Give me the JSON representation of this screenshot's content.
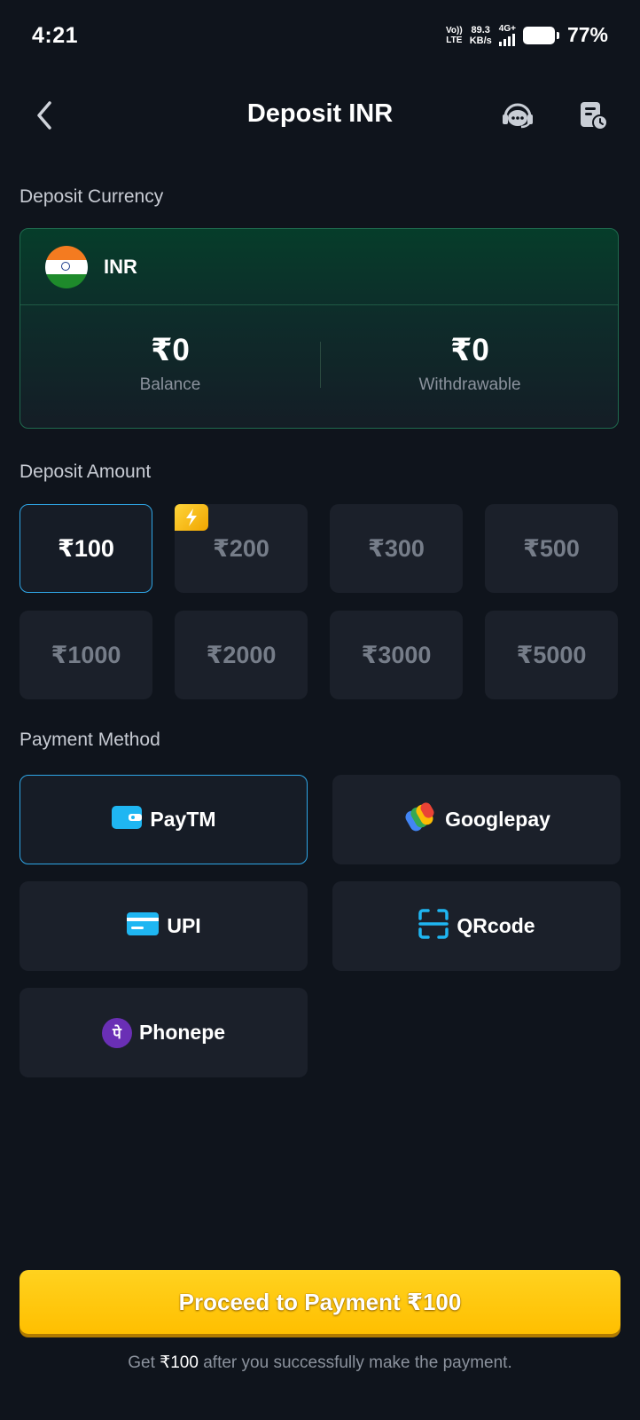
{
  "status_bar": {
    "time": "4:21",
    "network_top": "Vo))",
    "network_bottom": "LTE",
    "speed_value": "89.3",
    "speed_unit": "KB/s",
    "signal_type": "4G+",
    "battery": "77%"
  },
  "header": {
    "title": "Deposit INR",
    "back_icon": "chevron-left-icon",
    "support_icon": "support-chat-icon",
    "history_icon": "history-receipt-icon"
  },
  "deposit_currency": {
    "label": "Deposit Currency",
    "code": "INR",
    "balance_value": "₹0",
    "balance_label": "Balance",
    "withdrawable_value": "₹0",
    "withdrawable_label": "Withdrawable"
  },
  "deposit_amount": {
    "label": "Deposit Amount",
    "options": [
      "₹100",
      "₹200",
      "₹300",
      "₹500",
      "₹1000",
      "₹2000",
      "₹3000",
      "₹5000"
    ],
    "selected": "₹100"
  },
  "payment_method": {
    "label": "Payment Method",
    "methods": [
      "PayTM",
      "Googlepay",
      "UPI",
      "QRcode",
      "Phonepe"
    ],
    "selected": "PayTM",
    "phonepe_logo_glyph": "पे"
  },
  "proceed": {
    "label": "Proceed to Payment ₹100"
  },
  "footnote": {
    "prefix": "Get ",
    "amount": "₹100",
    "suffix": " after you successfully make the payment."
  },
  "colors": {
    "background": "#0f141c",
    "tile": "#1b202a",
    "selected_border": "#2fa6e6",
    "primary_button": "#ffc400",
    "card_green": "#063d2a"
  }
}
